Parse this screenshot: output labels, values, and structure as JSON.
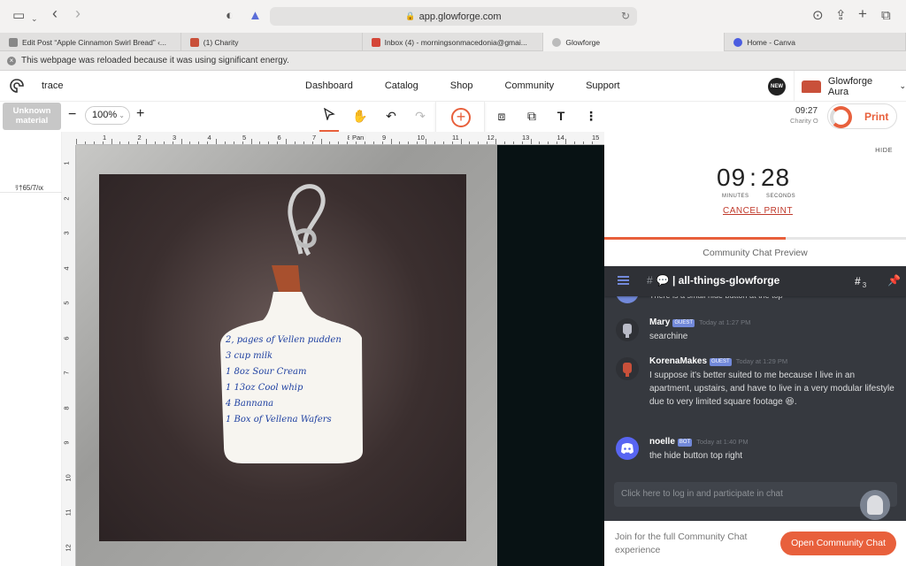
{
  "browser": {
    "url": "app.glowforge.com",
    "tabs": [
      {
        "label": "Edit Post “Apple Cinnamon Swirl Bread” ‹...",
        "active": false
      },
      {
        "label": "(1) Charity",
        "active": false
      },
      {
        "label": "Inbox (4) - morningsonmacedonia@gmai...",
        "active": false
      },
      {
        "label": "Glowforge",
        "active": true
      },
      {
        "label": "Home - Canva",
        "active": false
      }
    ],
    "notice": "This webpage was reloaded because it was using significant energy."
  },
  "app": {
    "project_name": "trace",
    "nav": [
      "Dashboard",
      "Catalog",
      "Shop",
      "Community",
      "Support"
    ],
    "new_badge": "NEW",
    "device_name": "Glowforge Aura"
  },
  "toolbar": {
    "material_line1": "Unknown",
    "material_line2": "material",
    "zoom_minus": "−",
    "zoom_value": "100%",
    "zoom_plus": "+",
    "tooltip": "Pan",
    "time_small": "09:27",
    "charity_small": "Charity O",
    "print_label": "Print"
  },
  "left_panel": {
    "label": "ﾘ†65/7/ιх"
  },
  "ruler": {
    "top": [
      "1",
      "2",
      "3",
      "4",
      "5",
      "6",
      "7",
      "8",
      "9",
      "10",
      "11",
      "12",
      "13",
      "14",
      "15"
    ],
    "left": [
      "1",
      "2",
      "3",
      "4",
      "5",
      "6",
      "7",
      "8",
      "9",
      "10",
      "11",
      "12"
    ]
  },
  "recipe_lines": [
    "2, pages of Vellen pudden",
    "3 cup milk",
    "1 8oz Sour Cream",
    "1 13oz Cool whip",
    "4 Bannana",
    "1 Box of Vellena Wafers"
  ],
  "print_panel": {
    "hide": "HIDE",
    "minutes": "09",
    "seconds": "28",
    "minutes_label": "MINUTES",
    "seconds_label": "SECONDS",
    "cancel": "CANCEL PRINT",
    "progress": 0.6,
    "chat_preview_title": "Community Chat Preview"
  },
  "discord": {
    "channel": "💬 | all-things-glowforge",
    "thread_count": "3",
    "cutoff_text": "There is a small hide button at the top",
    "messages": [
      {
        "user": "Mary",
        "tag": "GUEST",
        "time": "Today at 1:27 PM",
        "text": "searchine"
      },
      {
        "user": "KorenaMakes",
        "tag": "GUEST",
        "time": "Today at 1:29 PM",
        "text": "I suppose it's better suited to me because I live in an apartment, upstairs, and have to live in a very modular lifestyle due to very limited square footage 😆."
      },
      {
        "user": "noelle",
        "tag": "BOT",
        "time": "Today at 1:40 PM",
        "text": "the hide button top right"
      }
    ],
    "login_prompt": "Click here to log in and participate in chat"
  },
  "join": {
    "text": "Join for the full Community Chat experience",
    "button": "Open Community Chat"
  },
  "colors": {
    "accent": "#e8603c",
    "discord_bg": "#36393f",
    "discord_blurple": "#7289da"
  }
}
